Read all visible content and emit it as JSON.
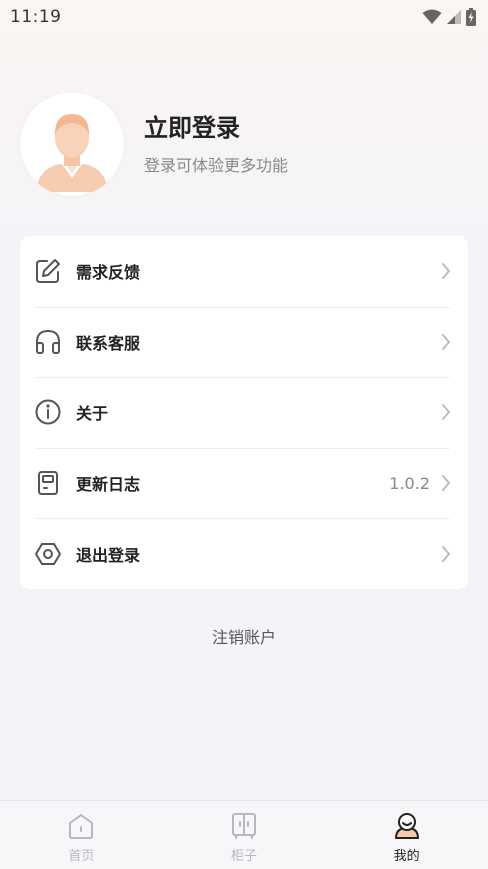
{
  "status_bar": {
    "time": "11:19"
  },
  "profile": {
    "title": "立即登录",
    "subtitle": "登录可体验更多功能"
  },
  "menu": {
    "items": [
      {
        "label": "需求反馈",
        "icon": "edit-icon",
        "value": ""
      },
      {
        "label": "联系客服",
        "icon": "headphones-icon",
        "value": ""
      },
      {
        "label": "关于",
        "icon": "info-icon",
        "value": ""
      },
      {
        "label": "更新日志",
        "icon": "log-book-icon",
        "value": "1.0.2"
      },
      {
        "label": "退出登录",
        "icon": "hexagon-logout-icon",
        "value": ""
      }
    ]
  },
  "cancel_account": "注销账户",
  "tabs": [
    {
      "label": "首页",
      "icon": "home-icon",
      "active": false
    },
    {
      "label": "柜子",
      "icon": "cabinet-icon",
      "active": false
    },
    {
      "label": "我的",
      "icon": "user-profile-icon",
      "active": true
    }
  ],
  "colors": {
    "icon": "#555555",
    "tab_inactive": "#b8b8bc",
    "tab_active": "#222222",
    "avatar_accent": "#f5c9ab"
  }
}
